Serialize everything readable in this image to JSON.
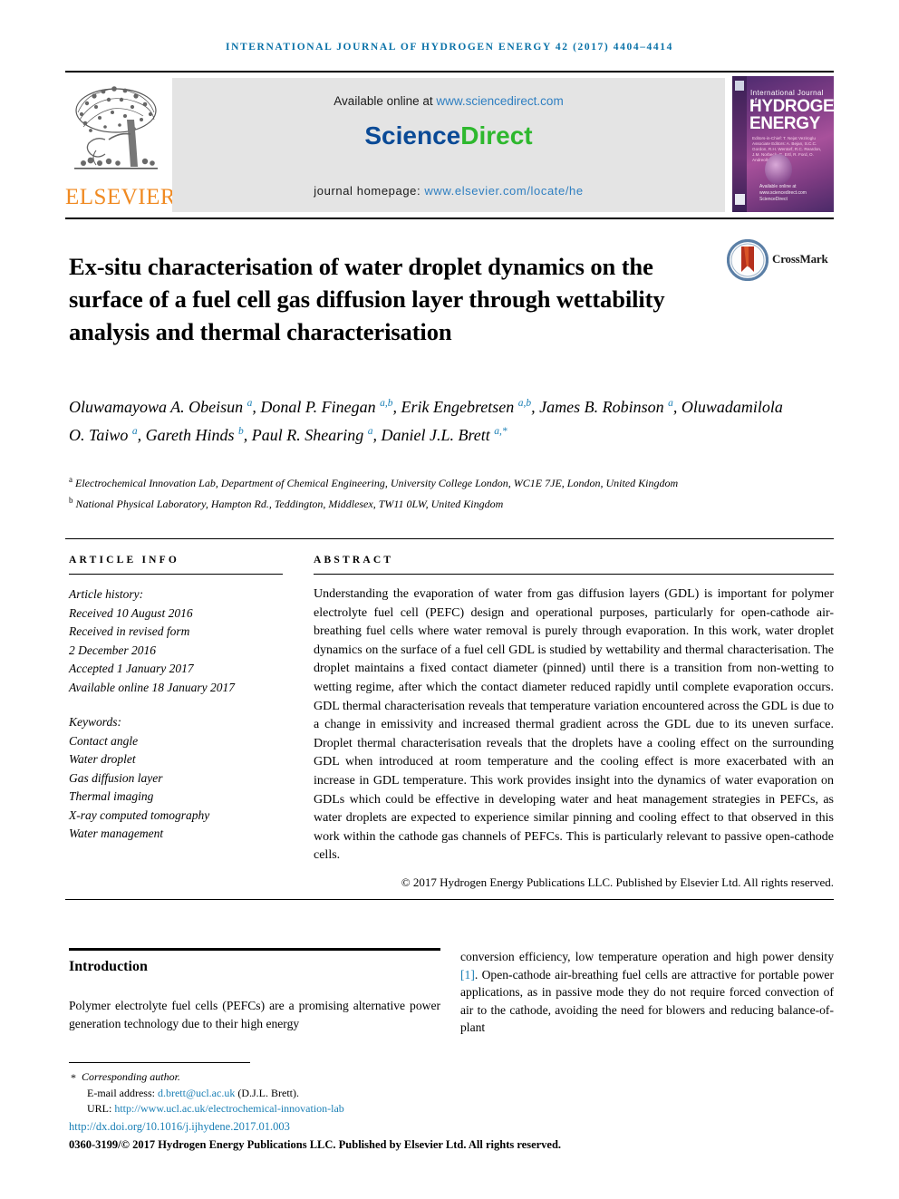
{
  "running_head": "International Journal of Hydrogen Energy 42 (2017) 4404–4414",
  "masthead": {
    "publisher_name": "ELSEVIER",
    "tree_logo_name": "elsevier-tree-logo",
    "available_prefix": "Available online at ",
    "available_link": "www.sciencedirect.com",
    "sciencedirect_part1": "Science",
    "sciencedirect_part2": "Direct",
    "homepage_prefix": "journal homepage: ",
    "homepage_link": "www.elsevier.com/locate/he",
    "cover": {
      "line_small": "International Journal of",
      "line_big_1": "HYDROGEN",
      "line_big_2": "ENERGY",
      "editors": "Editors-in-Chief: T. Nejat Veziroglu  Associate Editors: A. Bejan, S.C.C. Gordon, R.H. Wentorf, R.C. Reardon, J.M. Norbeck, G. Ertl, R. Ford, O. Andreolle",
      "sciencedirect_footer": "Available online at www.sciencedirect.com  ScienceDirect"
    }
  },
  "article": {
    "title": "Ex-situ characterisation of water droplet dynamics on the surface of a fuel cell gas diffusion layer through wettability analysis and thermal characterisation",
    "crossmark_label": "CrossMark",
    "authors_html": "Oluwamayowa A. Obeisun <sup>a</sup>, Donal P. Finegan <sup>a,b</sup>, Erik Engebretsen <sup>a,b</sup>, James B. Robinson <sup>a</sup>, Oluwadamilola O. Taiwo <sup>a</sup>, Gareth Hinds <sup>b</sup>, Paul R. Shearing <sup>a</sup>, Daniel J.L. Brett <sup>a,*</sup>",
    "affiliations": [
      {
        "marker": "a",
        "text": "Electrochemical Innovation Lab, Department of Chemical Engineering, University College London, WC1E 7JE, London, United Kingdom"
      },
      {
        "marker": "b",
        "text": "National Physical Laboratory, Hampton Rd., Teddington, Middlesex, TW11 0LW, United Kingdom"
      }
    ]
  },
  "article_info": {
    "heading": "Article info",
    "history_label": "Article history:",
    "history": [
      "Received 10 August 2016",
      "Received in revised form",
      "2 December 2016",
      "Accepted 1 January 2017",
      "Available online 18 January 2017"
    ],
    "keywords_label": "Keywords:",
    "keywords": [
      "Contact angle",
      "Water droplet",
      "Gas diffusion layer",
      "Thermal imaging",
      "X-ray computed tomography",
      "Water management"
    ]
  },
  "abstract": {
    "heading": "Abstract",
    "text": "Understanding the evaporation of water from gas diffusion layers (GDL) is important for polymer electrolyte fuel cell (PEFC) design and operational purposes, particularly for open-cathode air-breathing fuel cells where water removal is purely through evaporation. In this work, water droplet dynamics on the surface of a fuel cell GDL is studied by wettability and thermal characterisation. The droplet maintains a fixed contact diameter (pinned) until there is a transition from non-wetting to wetting regime, after which the contact diameter reduced rapidly until complete evaporation occurs. GDL thermal characterisation reveals that temperature variation encountered across the GDL is due to a change in emissivity and increased thermal gradient across the GDL due to its uneven surface. Droplet thermal characterisation reveals that the droplets have a cooling effect on the surrounding GDL when introduced at room temperature and the cooling effect is more exacerbated with an increase in GDL temperature. This work provides insight into the dynamics of water evaporation on GDLs which could be effective in developing water and heat management strategies in PEFCs, as water droplets are expected to experience similar pinning and cooling effect to that observed in this work within the cathode gas channels of PEFCs. This is particularly relevant to passive open-cathode cells.",
    "copyright": "© 2017 Hydrogen Energy Publications LLC. Published by Elsevier Ltd. All rights reserved."
  },
  "body": {
    "section_heading": "Introduction",
    "left_column": "Polymer electrolyte fuel cells (PEFCs) are a promising alternative power generation technology due to their high energy",
    "right_column_pre": "conversion efficiency, low temperature operation and high power density ",
    "right_column_ref": "[1]",
    "right_column_post": ". Open-cathode air-breathing fuel cells are attractive for portable power applications, as in passive mode they do not require forced convection of air to the cathode, avoiding the need for blowers and reducing balance-of-plant"
  },
  "footer": {
    "corresponding_marker": "*",
    "corresponding_author": "Corresponding author.",
    "email_label": "E-mail address: ",
    "email": "d.brett@ucl.ac.uk",
    "email_suffix": " (D.J.L. Brett).",
    "url_label": "URL: ",
    "url": "http://www.ucl.ac.uk/electrochemical-innovation-lab",
    "doi": "http://dx.doi.org/10.1016/j.ijhydene.2017.01.003",
    "issn_line": "0360-3199/© 2017 Hydrogen Energy Publications LLC. Published by Elsevier Ltd. All rights reserved."
  },
  "colors": {
    "journal_blue": "#0a72a8",
    "link_blue": "#1a7fb5",
    "elsevier_orange": "#f08a22",
    "sciencedirect_blue": "#0a4a96",
    "sciencedirect_green": "#2eb82e",
    "cover_purple": "#7b3b84"
  }
}
